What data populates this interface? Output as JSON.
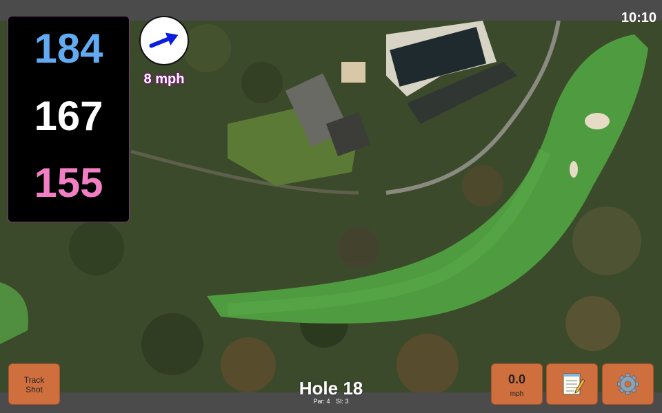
{
  "status_bar": {
    "time": "10:10"
  },
  "distances": {
    "back": "184",
    "middle": "167",
    "front": "155"
  },
  "wind": {
    "speed": "8 mph",
    "direction_icon": "wind-arrow-icon"
  },
  "controls": {
    "track_shot_line1": "Track",
    "track_shot_line2": "Shot",
    "speed_value": "0.0",
    "speed_unit": "mph",
    "notes_icon": "notepad-icon",
    "settings_icon": "gear-icon"
  },
  "hole": {
    "title": "Hole 18",
    "par": "Par: 4",
    "si": "SI: 3"
  },
  "colors": {
    "back_distance": "#62aaf2",
    "middle_distance": "#ffffff",
    "front_distance": "#f27fc4",
    "button": "#cf6f3e",
    "wind_arrow": "#0a1de0"
  }
}
